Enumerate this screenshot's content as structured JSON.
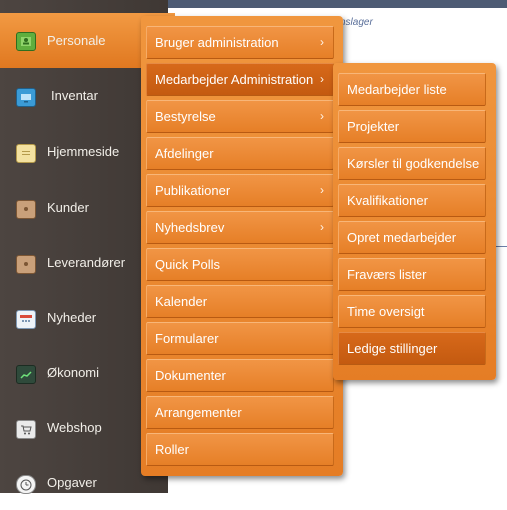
{
  "background": {
    "partial_text": "nslager"
  },
  "sidebar": {
    "items": [
      {
        "label": "Personale",
        "icon": "address-book-icon",
        "active": true
      },
      {
        "label": "Inventar",
        "icon": "monitor-icon"
      },
      {
        "label": "Hjemmeside",
        "icon": "note-icon"
      },
      {
        "label": "Kunder",
        "icon": "contacts-book-icon"
      },
      {
        "label": "Leverandører",
        "icon": "contacts-book-icon"
      },
      {
        "label": "Nyheder",
        "icon": "calendar-icon"
      },
      {
        "label": "Økonomi",
        "icon": "chart-icon"
      },
      {
        "label": "Webshop",
        "icon": "cart-icon"
      },
      {
        "label": "Opgaver",
        "icon": "clock-icon"
      }
    ]
  },
  "menu": {
    "items": [
      {
        "label": "Bruger administration",
        "submenu": true
      },
      {
        "label": "Medarbejder Administration",
        "submenu": true,
        "selected": true
      },
      {
        "label": "Bestyrelse",
        "submenu": true
      },
      {
        "label": "Afdelinger"
      },
      {
        "label": "Publikationer",
        "submenu": true
      },
      {
        "label": "Nyhedsbrev",
        "submenu": true
      },
      {
        "label": "Quick Polls"
      },
      {
        "label": "Kalender"
      },
      {
        "label": "Formularer"
      },
      {
        "label": "Dokumenter"
      },
      {
        "label": "Arrangementer"
      },
      {
        "label": "Roller"
      }
    ],
    "chevron": "›"
  },
  "submenu": {
    "items": [
      {
        "label": "Medarbejder liste"
      },
      {
        "label": "Projekter"
      },
      {
        "label": "Kørsler til godkendelse"
      },
      {
        "label": "Kvalifikationer"
      },
      {
        "label": "Opret medarbejder"
      },
      {
        "label": "Fraværs lister"
      },
      {
        "label": "Time oversigt"
      },
      {
        "label": "Ledige stillinger",
        "selected": true
      }
    ]
  },
  "colors": {
    "sidebar_bg": "#463e3a",
    "accent": "#e57d25",
    "accent_selected": "#c85c12"
  }
}
